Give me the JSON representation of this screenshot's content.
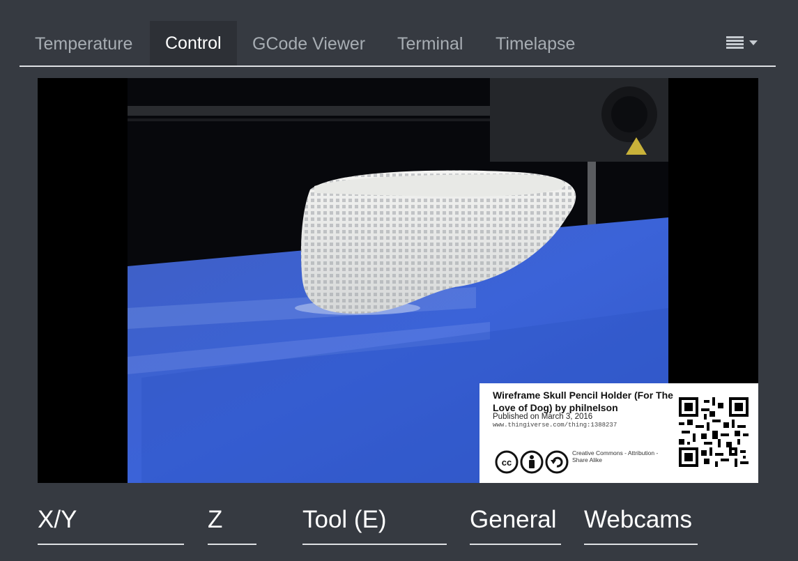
{
  "tabs": [
    {
      "label": "Temperature",
      "active": false
    },
    {
      "label": "Control",
      "active": true
    },
    {
      "label": "GCode Viewer",
      "active": false
    },
    {
      "label": "Terminal",
      "active": false
    },
    {
      "label": "Timelapse",
      "active": false
    }
  ],
  "webcam_overlay": {
    "title": "Wireframe Skull Pencil Holder (For The Love of Dog) by philnelson",
    "published": "Published on March 3, 2016",
    "url": "www.thingiverse.com/thing:1388237",
    "license": "Creative Commons - Attribution - Share Alike"
  },
  "sections": [
    {
      "label": "X/Y"
    },
    {
      "label": "Z"
    },
    {
      "label": "Tool (E)"
    },
    {
      "label": "General"
    },
    {
      "label": "Webcams"
    }
  ],
  "icons": {
    "tab_menu": "hamburger-icon",
    "tab_menu_caret": "caret-down-icon",
    "cc": "creative-commons-icon",
    "by": "attribution-icon",
    "sa": "share-alike-icon",
    "qr": "qr-code-icon"
  }
}
